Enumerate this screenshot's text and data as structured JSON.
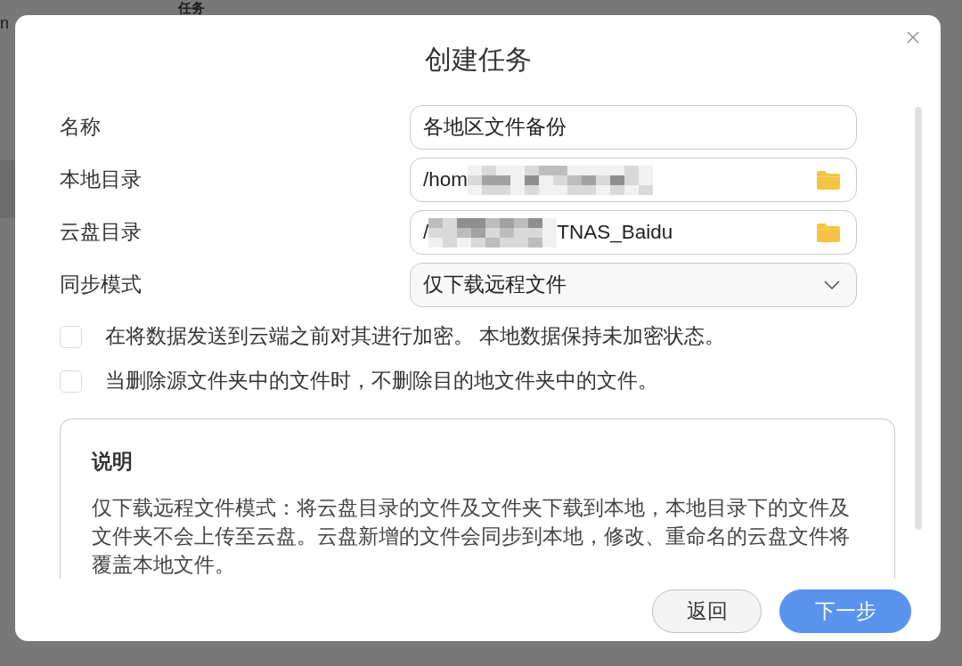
{
  "background": {
    "heading": "任务",
    "text": "n"
  },
  "dialog": {
    "title": "创建任务",
    "fields": [
      {
        "kind": "text",
        "label": "名称",
        "value": "各地区文件备份"
      },
      {
        "kind": "path",
        "label": "本地目录",
        "value": "/hom",
        "redacted": true
      },
      {
        "kind": "path",
        "label": "云盘目录",
        "value": "/",
        "redacted": true,
        "value_after": "TNAS_Baidu"
      },
      {
        "kind": "select",
        "label": "同步模式",
        "value": "仅下载远程文件"
      }
    ],
    "options": [
      {
        "label": "在将数据发送到云端之前对其进行加密。 本地数据保持未加密状态。",
        "checked": false
      },
      {
        "label": "当删除源文件夹中的文件时，不删除目的地文件夹中的文件。",
        "checked": false
      }
    ],
    "info": {
      "title": "说明",
      "text": "仅下载远程文件模式：将云盘目录的文件及文件夹下载到本地，本地目录下的文件及文件夹不会上传至云盘。云盘新增的文件会同步到本地，修改、重命名的云盘文件将覆盖本地文件。"
    },
    "buttons": [
      {
        "kind": "secondary",
        "label": "返回"
      },
      {
        "kind": "primary",
        "label": "下一步"
      }
    ]
  }
}
